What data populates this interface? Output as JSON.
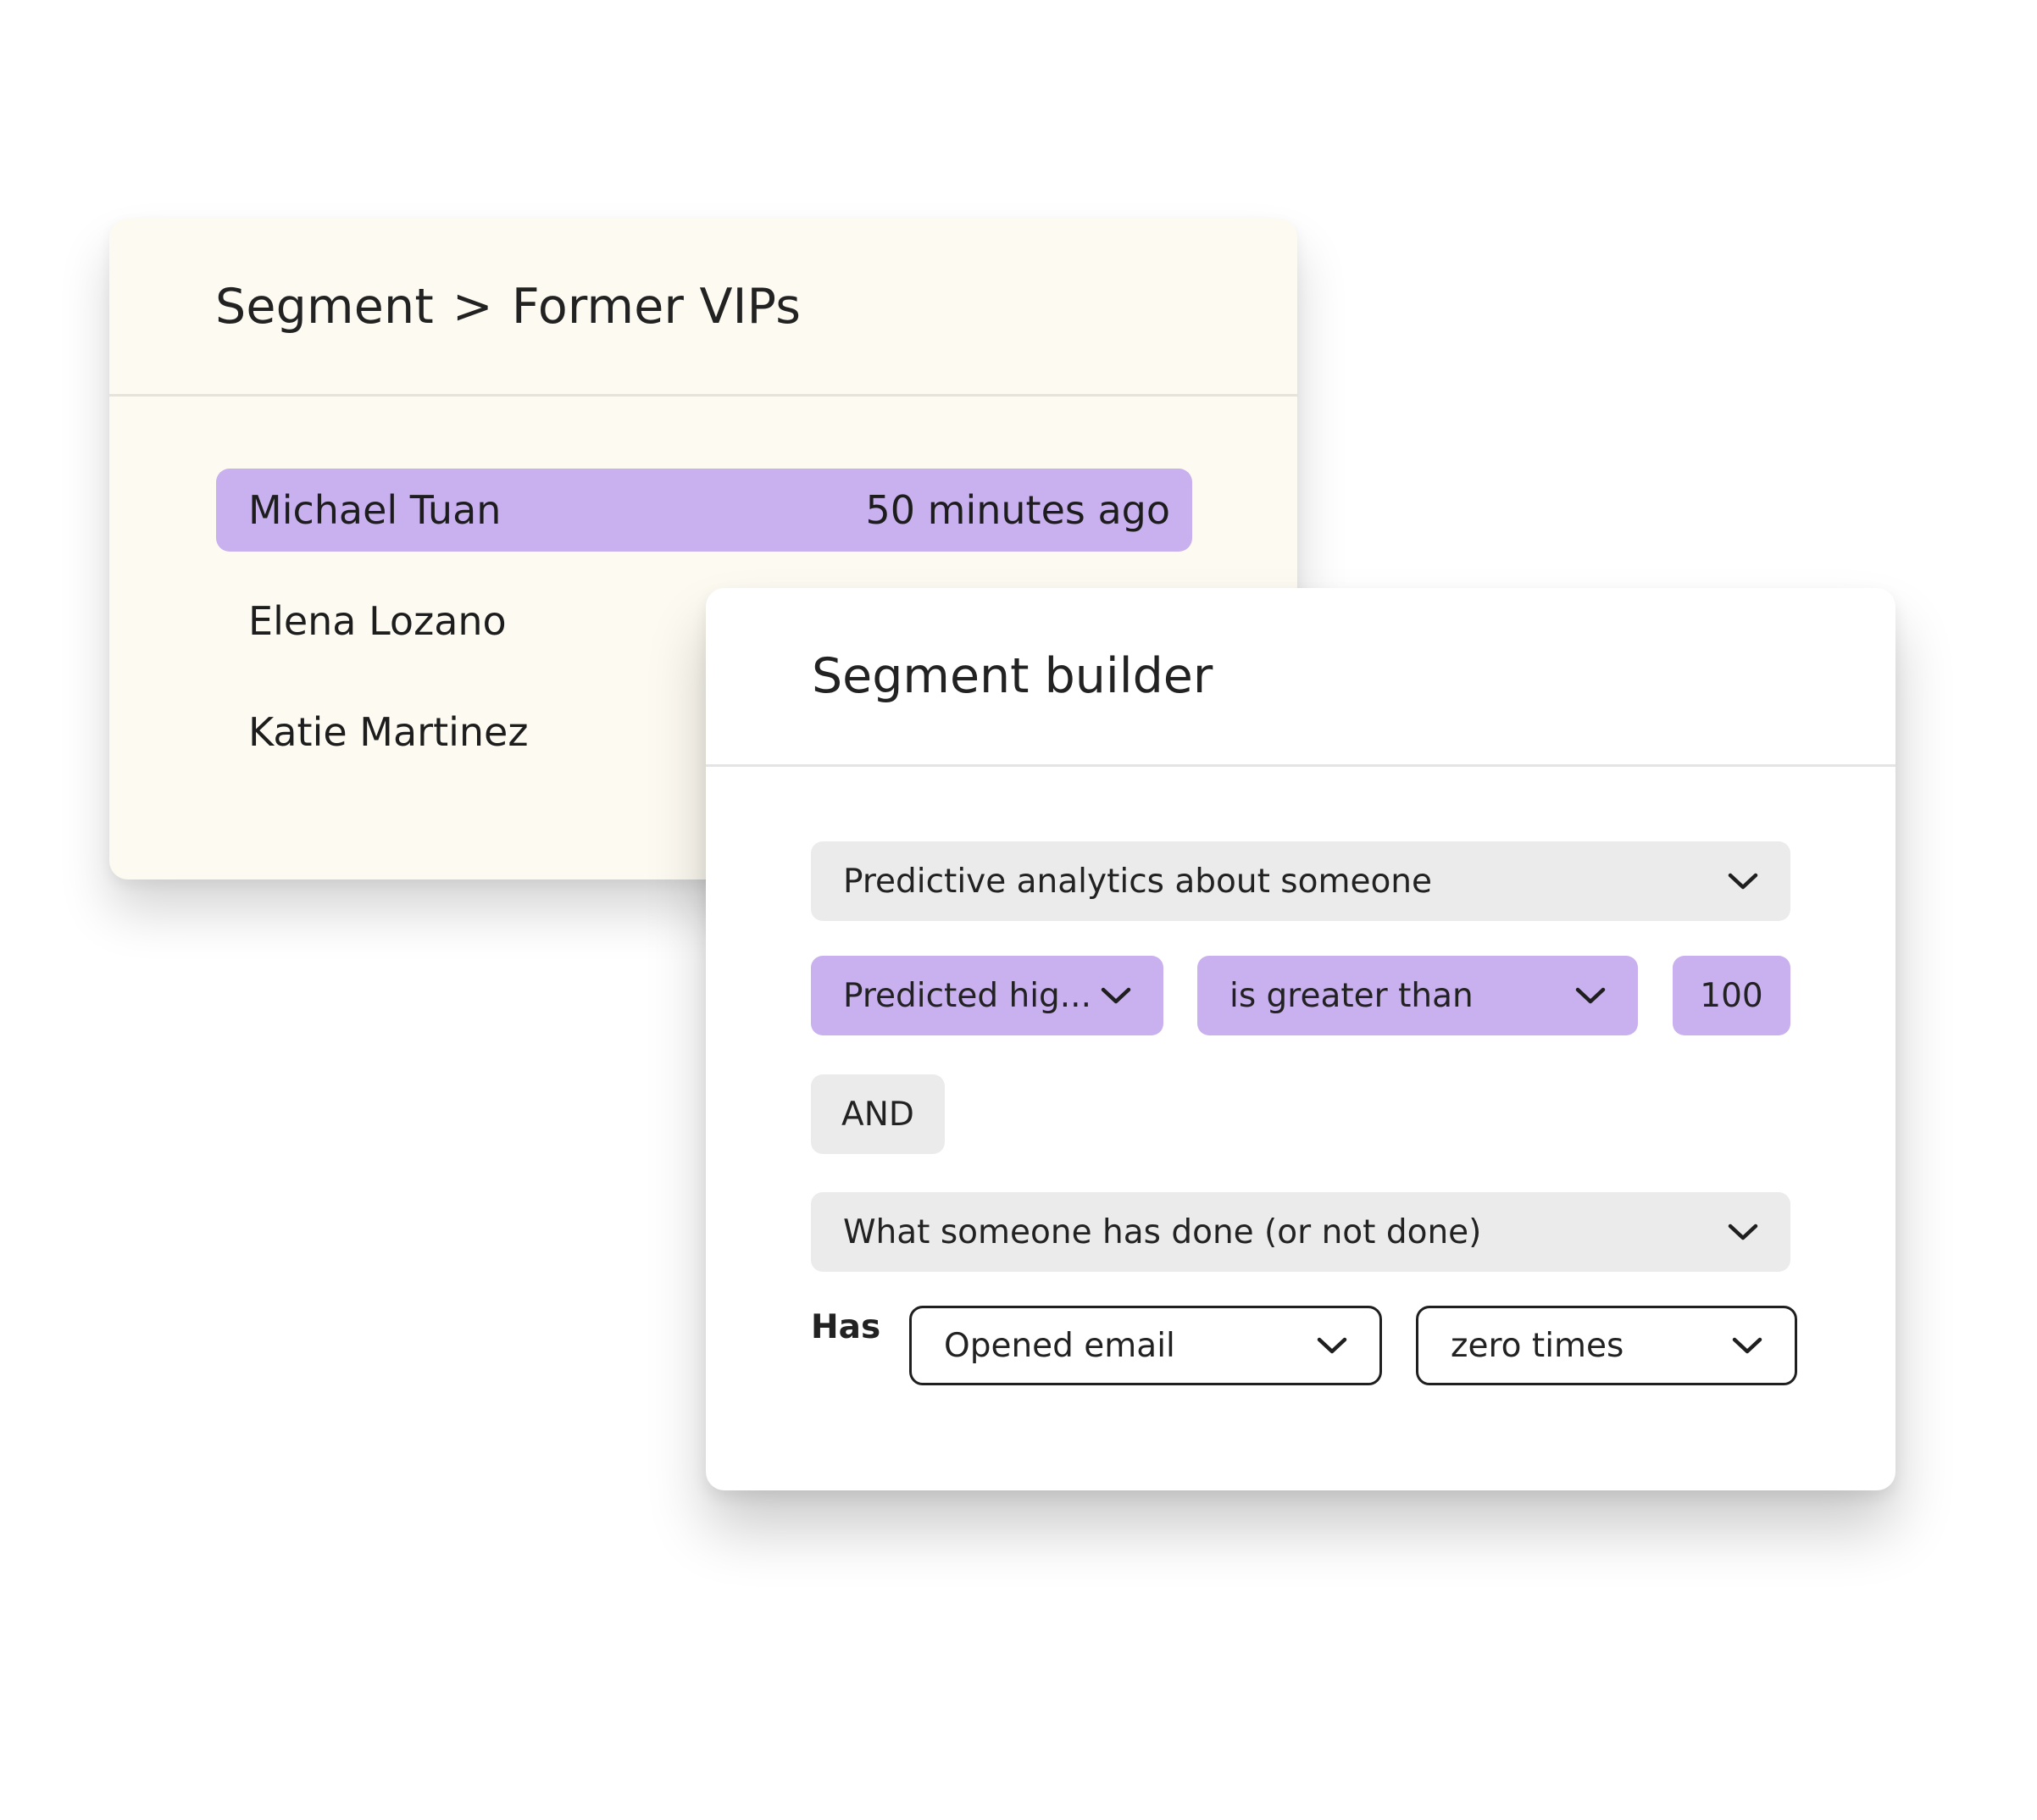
{
  "segment_list": {
    "breadcrumb": {
      "parent": "Segment",
      "separator": ">",
      "current": "Former VIPs"
    },
    "rows": [
      {
        "name": "Michael Tuan",
        "time": "50 minutes ago",
        "selected": true
      },
      {
        "name": "Elena Lozano",
        "time": ""
      },
      {
        "name": "Katie Martinez",
        "time": ""
      }
    ]
  },
  "segment_builder": {
    "title": "Segment builder",
    "condition_1_type": "Predictive analytics about someone",
    "condition_1_metric": "Predicted hig...",
    "condition_1_operator": "is greater than",
    "condition_1_value": "100",
    "joiner": "AND",
    "condition_2_type": "What someone has done (or not done)",
    "has_label": "Has",
    "condition_2_action": "Opened email",
    "condition_2_frequency": "zero times"
  },
  "colors": {
    "accent_purple": "#c9b0ee",
    "neutral_field": "#ebebeb",
    "back_card": "#fdfaf1"
  },
  "icons": {
    "dropdown": "chevron-down-icon"
  }
}
